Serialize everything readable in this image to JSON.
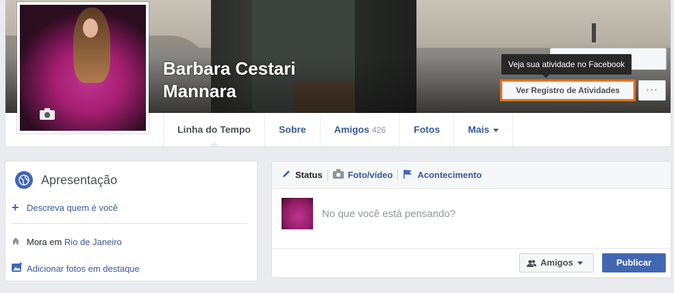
{
  "profile": {
    "name_line1": "Barbara Cestari",
    "name_line2": "Mannara"
  },
  "cover_actions": {
    "tooltip": "Veja sua atividade no Facebook",
    "activity_log_button": "Ver Registro de Atividades",
    "more_button": "···",
    "highlight_color": "#e2711d"
  },
  "tabs": [
    {
      "label": "Linha do Tempo",
      "count": ""
    },
    {
      "label": "Sobre",
      "count": ""
    },
    {
      "label": "Amigos",
      "count": "426"
    },
    {
      "label": "Fotos",
      "count": ""
    },
    {
      "label": "Mais",
      "count": ""
    }
  ],
  "intro": {
    "title": "Apresentação",
    "describe_link": "Descreva quem é você",
    "lives_prefix": "Mora em",
    "lives_city": "Rio de Janeiro",
    "add_photos_link": "Adicionar fotos em destaque"
  },
  "composer": {
    "tabs": [
      {
        "label": "Status",
        "icon": "pencil-icon"
      },
      {
        "label": "Foto/vídeo",
        "icon": "camera-icon"
      },
      {
        "label": "Acontecimento",
        "icon": "flag-icon"
      }
    ],
    "placeholder": "No que você está pensando?",
    "audience": "Amigos",
    "publish": "Publicar"
  },
  "colors": {
    "brand_blue": "#4267b2",
    "link_blue": "#365899",
    "page_bg": "#e9ebee"
  }
}
